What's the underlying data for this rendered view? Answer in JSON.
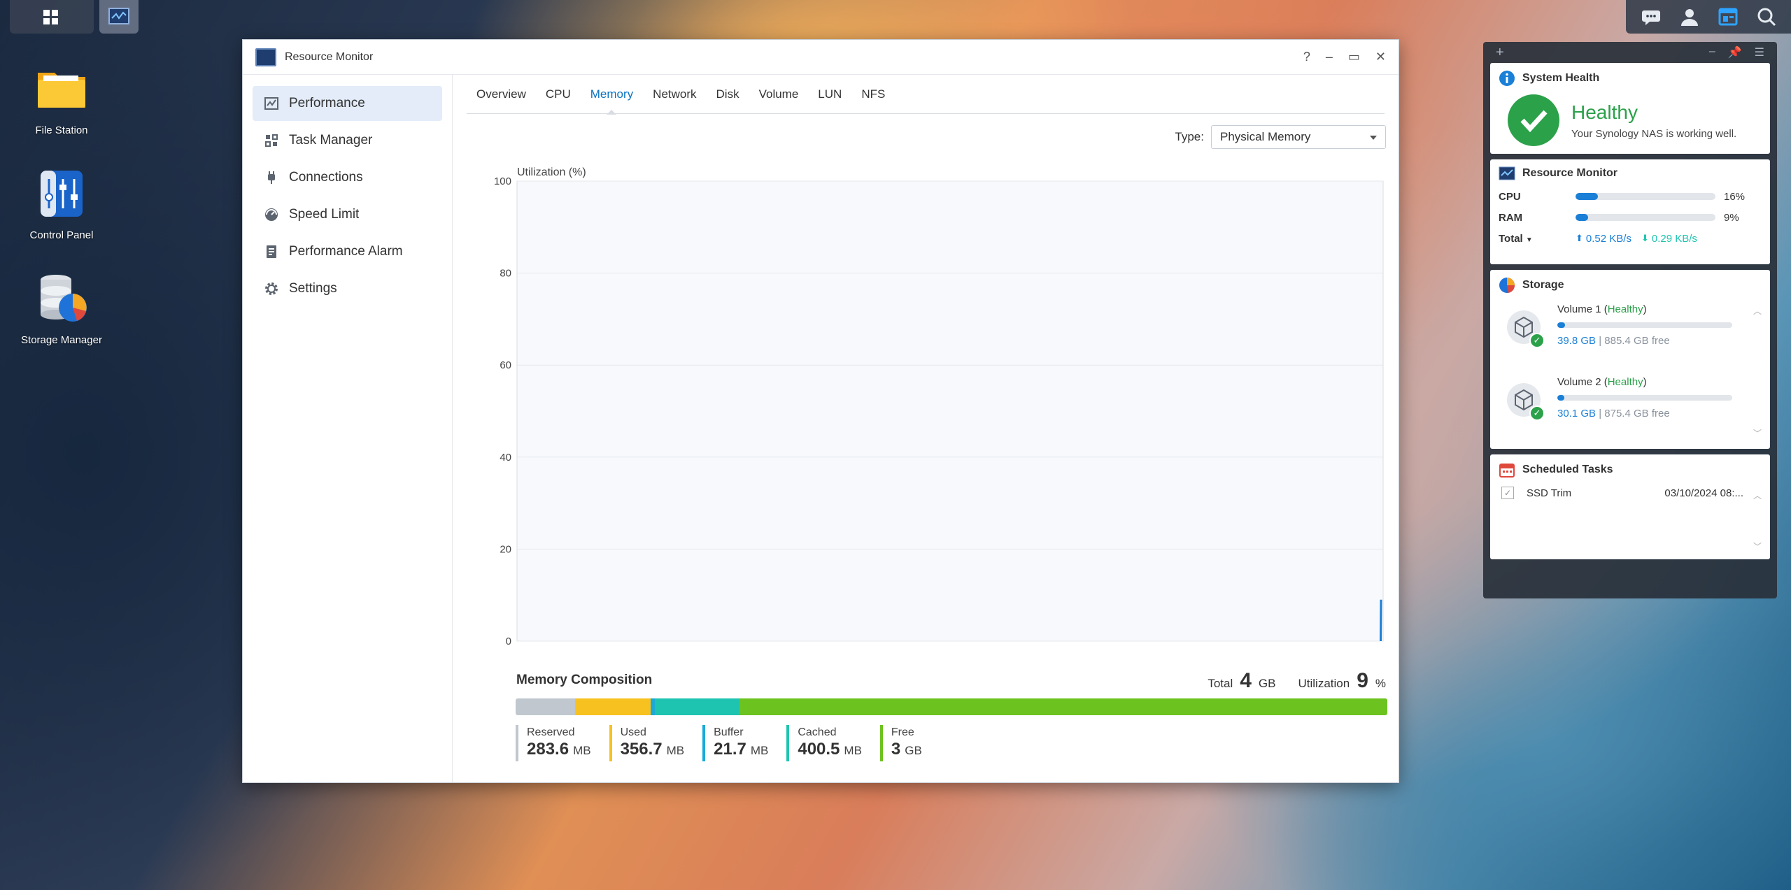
{
  "window": {
    "title": "Resource Monitor",
    "controls": {
      "help": "?",
      "minimize": "–",
      "maximize": "▭",
      "close": "✕"
    }
  },
  "desktop": {
    "icons": [
      {
        "label": "File Station"
      },
      {
        "label": "Control Panel"
      },
      {
        "label": "Storage Manager"
      }
    ]
  },
  "sidebar": {
    "items": [
      {
        "label": "Performance",
        "icon": "performance-icon",
        "active": true
      },
      {
        "label": "Task Manager",
        "icon": "task-manager-icon"
      },
      {
        "label": "Connections",
        "icon": "plug-icon"
      },
      {
        "label": "Speed Limit",
        "icon": "gauge-icon"
      },
      {
        "label": "Performance Alarm",
        "icon": "alarm-icon"
      },
      {
        "label": "Settings",
        "icon": "gear-icon"
      }
    ]
  },
  "tabs": [
    {
      "label": "Overview"
    },
    {
      "label": "CPU"
    },
    {
      "label": "Memory",
      "active": true
    },
    {
      "label": "Network"
    },
    {
      "label": "Disk"
    },
    {
      "label": "Volume"
    },
    {
      "label": "LUN"
    },
    {
      "label": "NFS"
    }
  ],
  "type_filter": {
    "label": "Type:",
    "value": "Physical Memory"
  },
  "chart_data": {
    "type": "line",
    "ylabel": "Utilization (%)",
    "ylim": [
      0,
      100
    ],
    "yticks": [
      0,
      20,
      40,
      60,
      80,
      100
    ],
    "grid": true,
    "series": [
      {
        "values": [
          0,
          9
        ],
        "color": "#1a7fd6"
      }
    ]
  },
  "composition": {
    "title": "Memory Composition",
    "total_label": "Total",
    "total_value": "4",
    "total_unit": "GB",
    "util_label": "Utilization",
    "util_value": "9",
    "util_unit": "%",
    "segments": [
      {
        "name": "Reserved",
        "value": "283.6",
        "unit": "MB",
        "mb": 283.6,
        "color": "#c0c7cf"
      },
      {
        "name": "Used",
        "value": "356.7",
        "unit": "MB",
        "mb": 356.7,
        "color": "#f7c21f"
      },
      {
        "name": "Buffer",
        "value": "21.7",
        "unit": "MB",
        "mb": 21.7,
        "color": "#1ba9d8"
      },
      {
        "name": "Cached",
        "value": "400.5",
        "unit": "MB",
        "mb": 400.5,
        "color": "#1ec4b0"
      },
      {
        "name": "Free",
        "value": "3",
        "unit": "GB",
        "mb": 3072,
        "color": "#6cc21e"
      }
    ]
  },
  "widgets": {
    "system_health": {
      "title": "System Health",
      "status": "Healthy",
      "message": "Your Synology NAS is working well."
    },
    "resource_monitor": {
      "title": "Resource Monitor",
      "cpu_label": "CPU",
      "cpu_pct": "16%",
      "cpu_fraction": 0.16,
      "ram_label": "RAM",
      "ram_pct": "9%",
      "ram_fraction": 0.09,
      "total_label": "Total",
      "upload": "0.52 KB/s",
      "download": "0.29 KB/s"
    },
    "storage": {
      "title": "Storage",
      "volumes": [
        {
          "name": "Volume 1",
          "status": "Healthy",
          "used": "39.8 GB",
          "free": "885.4 GB free",
          "fraction": 0.043
        },
        {
          "name": "Volume 2",
          "status": "Healthy",
          "used": "30.1 GB",
          "free": "875.4 GB free",
          "fraction": 0.033
        }
      ]
    },
    "scheduled_tasks": {
      "title": "Scheduled Tasks",
      "tasks": [
        {
          "name": "SSD Trim",
          "time": "03/10/2024 08:..."
        }
      ]
    }
  },
  "colors": {
    "accent": "#0a72c0",
    "healthy": "#2ba14a"
  }
}
